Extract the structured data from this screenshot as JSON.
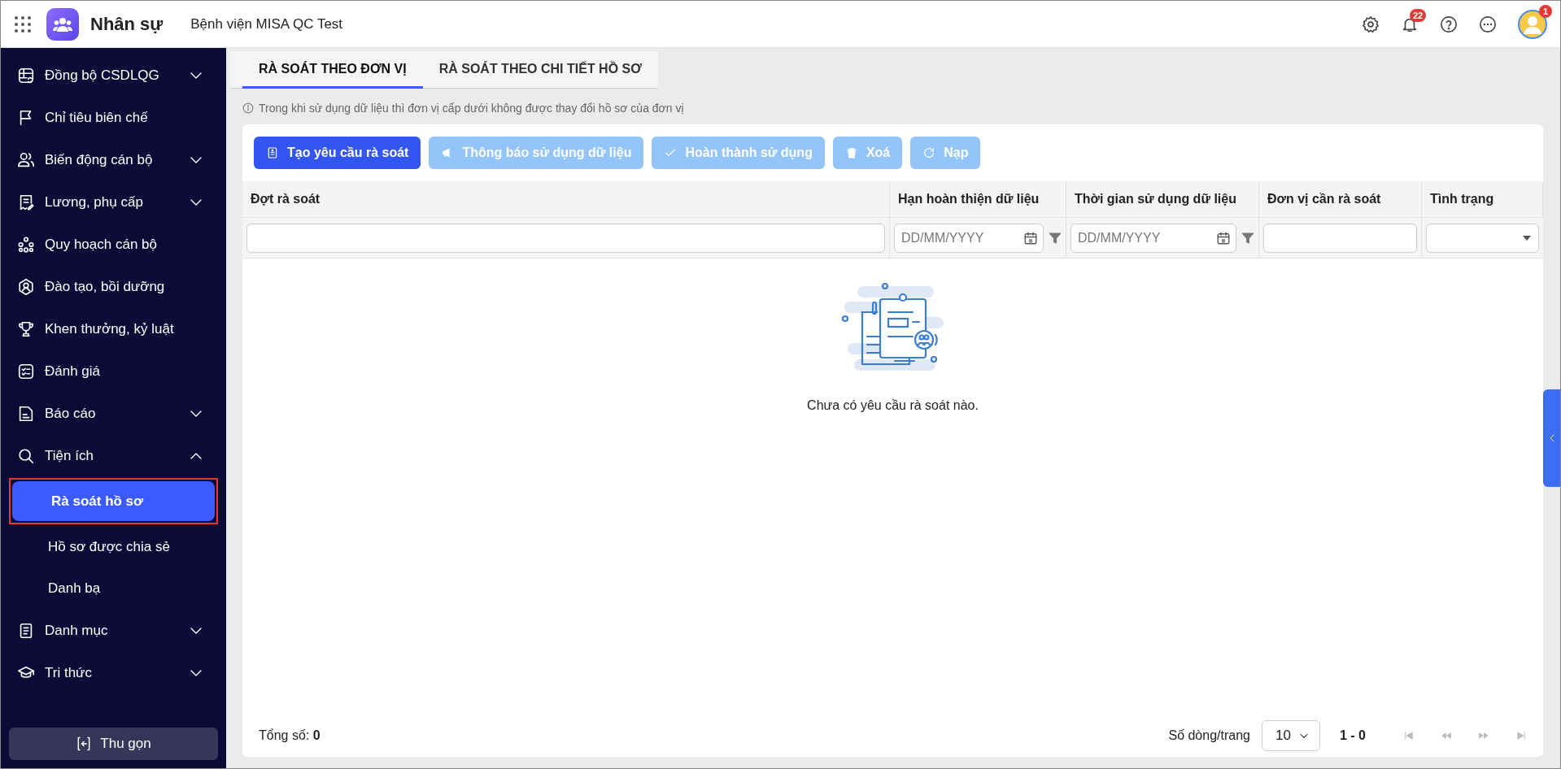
{
  "topbar": {
    "app_name": "Nhân sự",
    "organization": "Bệnh viện MISA QC Test",
    "notification_count": "22",
    "avatar_badge": "1"
  },
  "sidebar": {
    "items": [
      {
        "label": "Đồng bộ CSDLQG",
        "kind": "group",
        "expanded": false
      },
      {
        "label": "Chỉ tiêu biên chế",
        "kind": "link"
      },
      {
        "label": "Biến động cán bộ",
        "kind": "group",
        "expanded": false
      },
      {
        "label": "Lương, phụ cấp",
        "kind": "group",
        "expanded": false
      },
      {
        "label": "Quy hoạch cán bộ",
        "kind": "link"
      },
      {
        "label": "Đào tạo, bồi dưỡng",
        "kind": "link"
      },
      {
        "label": "Khen thưởng, kỷ luật",
        "kind": "link"
      },
      {
        "label": "Đánh giá",
        "kind": "link"
      },
      {
        "label": "Báo cáo",
        "kind": "group",
        "expanded": false
      },
      {
        "label": "Tiện ích",
        "kind": "group",
        "expanded": true,
        "children": [
          {
            "label": "Rà soát hồ sơ",
            "selected": true,
            "highlighted": true
          },
          {
            "label": "Hồ sơ được chia sẻ",
            "selected": false,
            "highlighted": false
          },
          {
            "label": "Danh bạ",
            "selected": false,
            "highlighted": false
          }
        ]
      },
      {
        "label": "Danh mục",
        "kind": "group",
        "expanded": false
      },
      {
        "label": "Tri thức",
        "kind": "group",
        "expanded": false
      }
    ],
    "collapse_button": "Thu gọn"
  },
  "tabs": [
    {
      "label": "RÀ SOÁT THEO ĐƠN VỊ",
      "selected": true
    },
    {
      "label": "RÀ SOÁT THEO CHI TIẾT HỒ SƠ",
      "selected": false
    }
  ],
  "info_note": "Trong khi sử dụng dữ liệu thì đơn vị cấp dưới không được thay đổi hồ sơ của đơn vị",
  "toolbar": [
    {
      "label": "Tạo yêu cầu rà soát",
      "disabled": false
    },
    {
      "label": "Thông báo sử dụng dữ liệu",
      "disabled": true
    },
    {
      "label": "Hoàn thành sử dụng",
      "disabled": true
    },
    {
      "label": "Xoá",
      "disabled": true
    },
    {
      "label": "Nạp",
      "disabled": true
    }
  ],
  "table": {
    "columns": [
      {
        "title": "Đợt rà soát",
        "filter": {
          "kind": "text"
        }
      },
      {
        "title": "Hạn hoàn thiện dữ liệu",
        "filter": {
          "kind": "date",
          "placeholder": "DD/MM/YYYY"
        }
      },
      {
        "title": "Thời gian sử dụng dữ liệu",
        "filter": {
          "kind": "date",
          "placeholder": "DD/MM/YYYY"
        }
      },
      {
        "title": "Đơn vị cần rà soát",
        "filter": {
          "kind": "text"
        }
      },
      {
        "title": "Tình trạng",
        "filter": {
          "kind": "select"
        }
      }
    ],
    "empty_message": "Chưa có yêu cầu rà soát nào."
  },
  "footer": {
    "total": "Tổng số: **0**",
    "rows_per_page_label": "Số dòng/trang",
    "rows_per_page": "10",
    "range": "1 - 0"
  }
}
